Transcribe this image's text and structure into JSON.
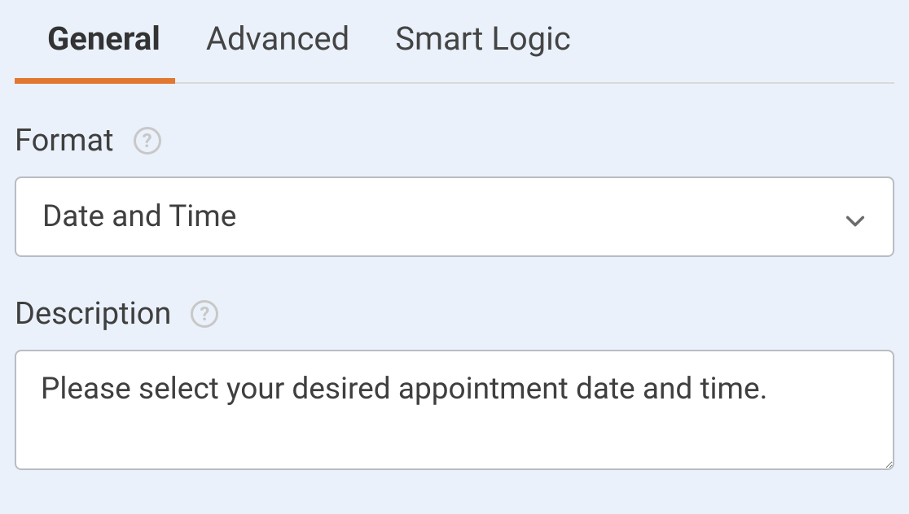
{
  "tabs": {
    "general": "General",
    "advanced": "Advanced",
    "smart_logic": "Smart Logic"
  },
  "fields": {
    "format": {
      "label": "Format",
      "value": "Date and Time"
    },
    "description": {
      "label": "Description",
      "value": "Please select your desired appointment date and time."
    }
  }
}
